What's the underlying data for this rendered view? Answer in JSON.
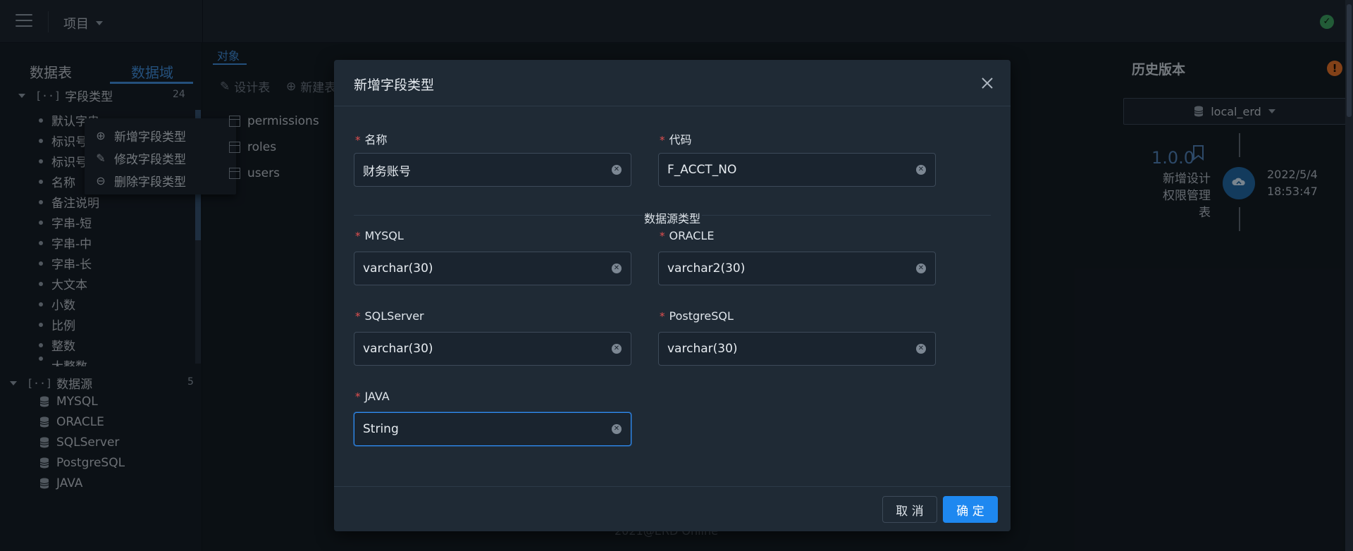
{
  "topbar": {
    "project_label": "项目"
  },
  "sidebar": {
    "tabs": [
      "数据表",
      "数据域"
    ],
    "field_types_group": {
      "label": "字段类型",
      "count": "24"
    },
    "field_types": [
      "默认字串",
      "标识号",
      "标识号",
      "名称",
      "备注说明",
      "字串-短",
      "字串-中",
      "字串-长",
      "大文本",
      "小数",
      "比例",
      "整数",
      "大整数"
    ],
    "data_source_group": {
      "label": "数据源",
      "count": "5"
    },
    "data_sources": [
      "MYSQL",
      "ORACLE",
      "SQLServer",
      "PostgreSQL",
      "JAVA"
    ],
    "context_menu": [
      "新增字段类型",
      "修改字段类型",
      "删除字段类型"
    ]
  },
  "main": {
    "tab": "对象",
    "toolbar": [
      "设计表",
      "新建表"
    ],
    "entities": [
      "permissions",
      "roles",
      "users"
    ],
    "footer": "2021@ERD Online"
  },
  "history": {
    "title": "历史版本",
    "env": "local_erd",
    "version": "1.0.0",
    "desc_lines": [
      "新增设计",
      "权限管理",
      "表"
    ],
    "date": "2022/5/4",
    "time": "18:53:47"
  },
  "modal": {
    "title": "新增字段类型",
    "fields": {
      "name": {
        "label": "名称",
        "value": "财务账号"
      },
      "code": {
        "label": "代码",
        "value": "F_ACCT_NO"
      },
      "mysql": {
        "label": "MYSQL",
        "value": "varchar(30)"
      },
      "oracle": {
        "label": "ORACLE",
        "value": "varchar2(30)"
      },
      "sqlserver": {
        "label": "SQLServer",
        "value": "varchar(30)"
      },
      "postgresql": {
        "label": "PostgreSQL",
        "value": "varchar(30)"
      },
      "java": {
        "label": "JAVA",
        "value": "String"
      }
    },
    "divider": "数据源类型",
    "cancel": "取 消",
    "ok": "确 定"
  },
  "colors": {
    "accent": "#1e88f0",
    "required": "#e04f4f",
    "tab_active": "#3f8bd6"
  }
}
